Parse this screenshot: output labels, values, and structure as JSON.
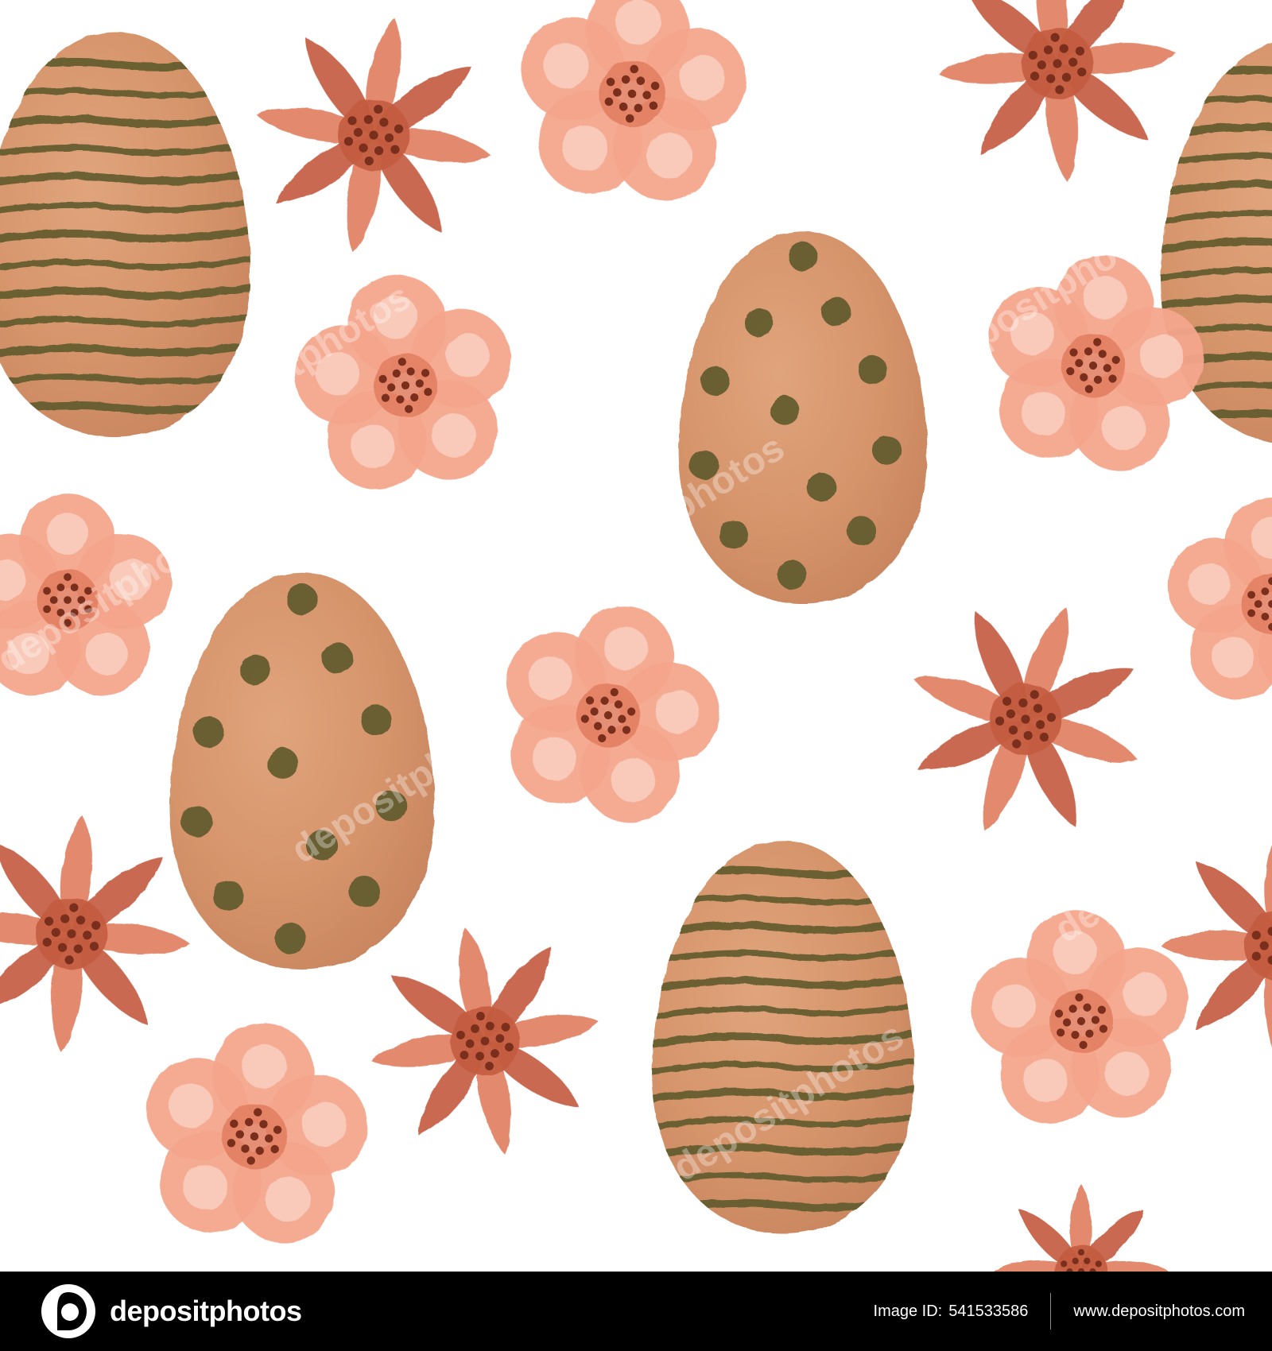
{
  "artwork": {
    "colors": {
      "background": "#ffffff",
      "egg_fill": "#d89870",
      "egg_shadow": "#c8855f",
      "egg_pattern": "#5f5a2c",
      "round_flower_petal": "#f4a58c",
      "round_flower_highlight": "#fbd6c8",
      "star_flower_petal": "#e07d5e",
      "star_flower_dark": "#c35a3e",
      "flower_center_dots": "#7a2e1c"
    },
    "icons": [
      "striped-easter-egg",
      "dotted-easter-egg",
      "round-five-petal-flower",
      "eight-point-star-flower"
    ]
  },
  "watermark": {
    "text": "depositphotos"
  },
  "footer": {
    "brand_name": "depositphotos",
    "image_id_label": "Image ID:",
    "image_id_value": "541533586",
    "website": "www.depositphotos.com",
    "background": "#000000"
  }
}
